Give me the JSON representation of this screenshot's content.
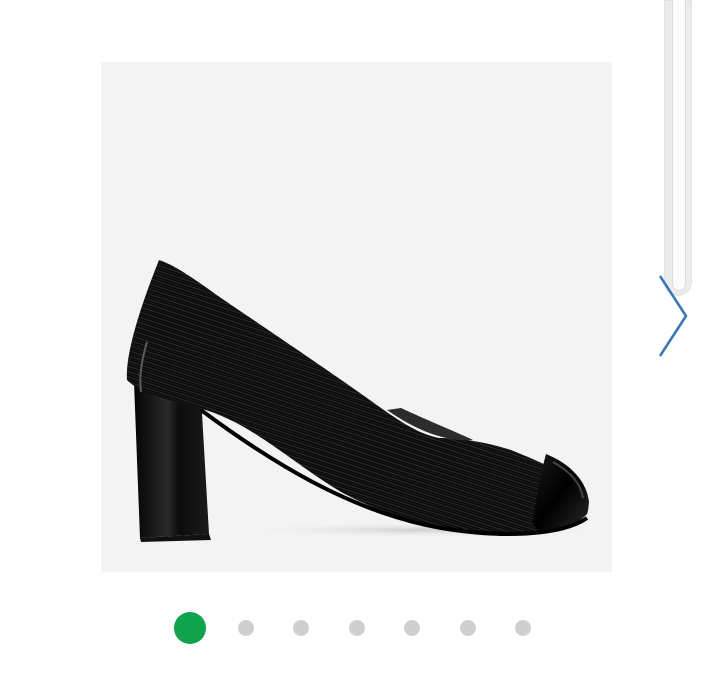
{
  "gallery": {
    "product_image_icon": "black-block-heel-pump-image",
    "next_icon": "chevron-right-icon",
    "next_arrow_color": "#3d79b3",
    "dots": {
      "count": 7,
      "active_index": 0,
      "active_color": "#0fa34d",
      "inactive_color": "#cfcfcf"
    }
  }
}
